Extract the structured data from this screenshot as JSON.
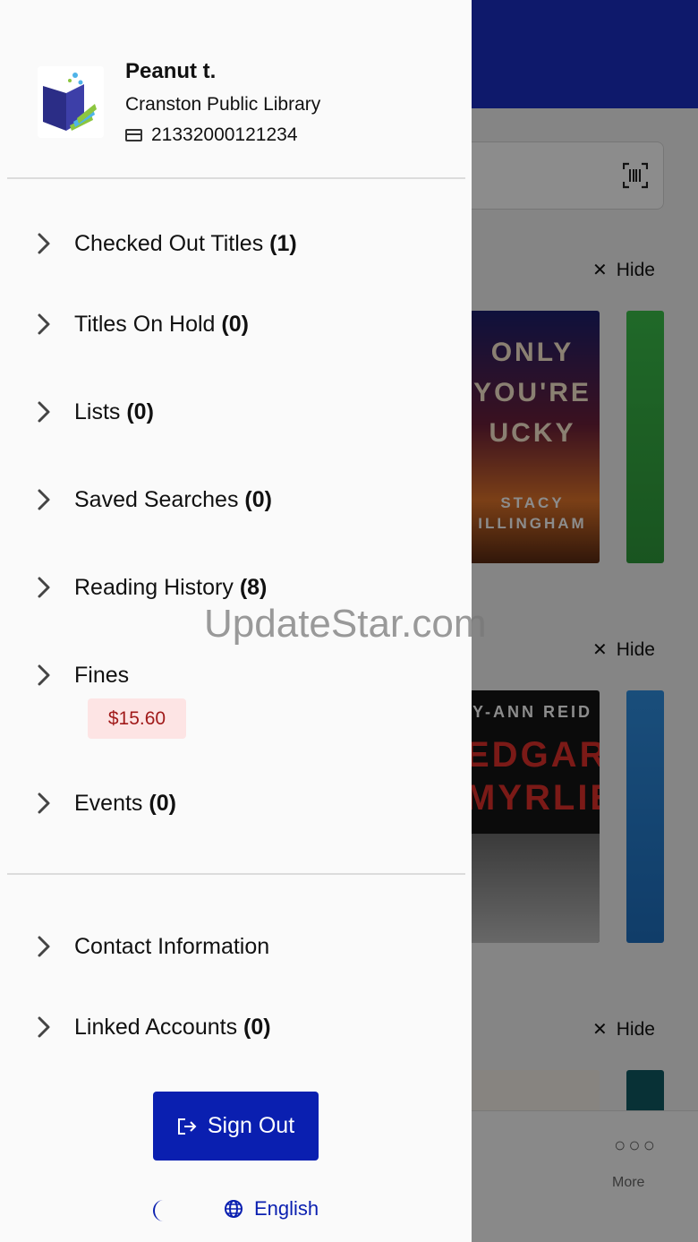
{
  "user": {
    "name": "Peanut t.",
    "library": "Cranston Public Library",
    "card_number": "21332000121234"
  },
  "menu": {
    "checked_out": {
      "label": "Checked Out Titles",
      "count": "(1)"
    },
    "on_hold": {
      "label": "Titles On Hold",
      "count": "(0)"
    },
    "lists": {
      "label": "Lists",
      "count": "(0)"
    },
    "saved_searches": {
      "label": "Saved Searches",
      "count": "(0)"
    },
    "reading_history": {
      "label": "Reading History",
      "count": "(8)"
    },
    "fines": {
      "label": "Fines",
      "amount": "$15.60"
    },
    "events": {
      "label": "Events",
      "count": "(0)"
    },
    "contact": {
      "label": "Contact Information"
    },
    "linked": {
      "label": "Linked Accounts",
      "count": "(0)"
    }
  },
  "actions": {
    "sign_out": "Sign Out",
    "language": "English"
  },
  "background": {
    "hide_label": "Hide",
    "tab_more": "More",
    "covers": {
      "c1_lines": [
        "ONLY",
        "YOU'RE",
        "UCKY"
      ],
      "c1_author": [
        "STACY",
        "ILLINGHAM"
      ],
      "c3_author": "Y-ANN REID",
      "c3_title": [
        "EDGAR",
        "MYRLIE"
      ]
    }
  },
  "watermark": "UpdateStar.com",
  "colors": {
    "brand": "#0a1fb0",
    "fine_badge_bg": "#fde4e4",
    "fine_badge_text": "#a11a1a"
  }
}
